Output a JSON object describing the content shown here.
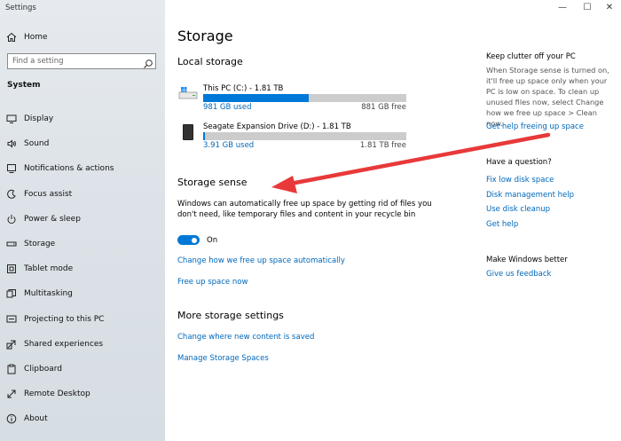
{
  "app": {
    "title": "Settings"
  },
  "window": {
    "minimize": "—",
    "maximize": "☐",
    "close": "✕"
  },
  "sidebar": {
    "home_label": "Home",
    "search_placeholder": "Find a setting",
    "section": "System",
    "items": [
      {
        "label": "Display",
        "icon": "display-icon"
      },
      {
        "label": "Sound",
        "icon": "sound-icon"
      },
      {
        "label": "Notifications & actions",
        "icon": "notifications-icon"
      },
      {
        "label": "Focus assist",
        "icon": "focus-assist-icon"
      },
      {
        "label": "Power & sleep",
        "icon": "power-icon"
      },
      {
        "label": "Storage",
        "icon": "storage-icon"
      },
      {
        "label": "Tablet mode",
        "icon": "tablet-icon"
      },
      {
        "label": "Multitasking",
        "icon": "multitasking-icon"
      },
      {
        "label": "Projecting to this PC",
        "icon": "projecting-icon"
      },
      {
        "label": "Shared experiences",
        "icon": "shared-icon"
      },
      {
        "label": "Clipboard",
        "icon": "clipboard-icon"
      },
      {
        "label": "Remote Desktop",
        "icon": "remote-desktop-icon"
      },
      {
        "label": "About",
        "icon": "about-icon"
      }
    ]
  },
  "main": {
    "title": "Storage",
    "local_storage": {
      "heading": "Local storage",
      "drives": [
        {
          "name": "This PC (C:) - 1.81 TB",
          "used": "981 GB used",
          "free": "881 GB free",
          "fill_fraction": 0.52
        },
        {
          "name": "Seagate Expansion Drive (D:) - 1.81 TB",
          "used": "3.91 GB used",
          "free": "1.81 TB free",
          "fill_fraction": 0.01
        }
      ]
    },
    "storage_sense": {
      "heading": "Storage sense",
      "description": "Windows can automatically free up space by getting rid of files you don't need, like temporary files and content in your recycle bin",
      "toggle_label": "On",
      "link_change": "Change how we free up space automatically",
      "link_free": "Free up space now"
    },
    "more": {
      "heading": "More storage settings",
      "link_new_content": "Change where new content is saved",
      "link_spaces": "Manage Storage Spaces"
    }
  },
  "right": {
    "clutter_heading": "Keep clutter off your PC",
    "clutter_text": "When Storage sense is turned on, it'll free up space only when your PC is low on space. To clean up unused files now, select Change how we free up space > Clean now.",
    "clutter_link": "Get help freeing up space",
    "question_heading": "Have a question?",
    "question_links": [
      "Fix low disk space",
      "Disk management help",
      "Use disk cleanup",
      "Get help"
    ],
    "better_heading": "Make Windows better",
    "feedback_link": "Give us feedback"
  },
  "colors": {
    "accent": "#0078d7",
    "link": "#0067b8",
    "arrow": "#e8393a"
  }
}
